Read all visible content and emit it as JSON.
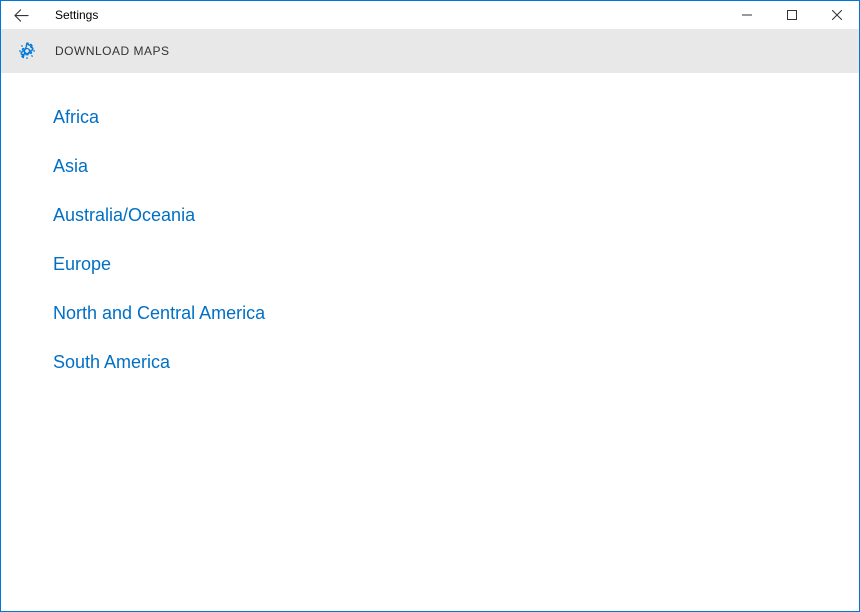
{
  "window": {
    "title": "Settings"
  },
  "header": {
    "page_title": "DOWNLOAD MAPS"
  },
  "regions": [
    {
      "label": "Africa"
    },
    {
      "label": "Asia"
    },
    {
      "label": "Australia/Oceania"
    },
    {
      "label": "Europe"
    },
    {
      "label": "North and Central America"
    },
    {
      "label": "South America"
    }
  ]
}
